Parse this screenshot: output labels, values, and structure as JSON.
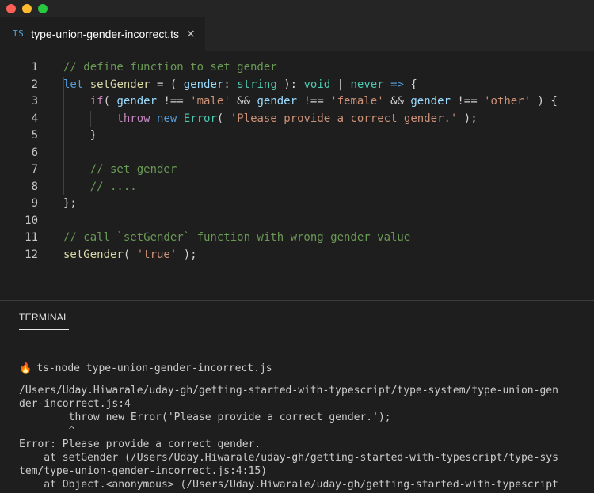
{
  "window": {
    "tab": {
      "icon": "TS",
      "filename": "type-union-gender-incorrect.ts",
      "close_glyph": "×"
    }
  },
  "editor": {
    "lines": [
      {
        "num": "1",
        "tokens": [
          {
            "t": "// define function to set gender",
            "c": "comment"
          }
        ]
      },
      {
        "num": "2",
        "tokens": [
          {
            "t": "let",
            "c": "keyword"
          },
          {
            "t": " ",
            "c": "punct"
          },
          {
            "t": "setGender",
            "c": "func"
          },
          {
            "t": " = ( ",
            "c": "punct"
          },
          {
            "t": "gender",
            "c": "var"
          },
          {
            "t": ": ",
            "c": "punct"
          },
          {
            "t": "string",
            "c": "type"
          },
          {
            "t": " ): ",
            "c": "punct"
          },
          {
            "t": "void",
            "c": "type"
          },
          {
            "t": " | ",
            "c": "punct"
          },
          {
            "t": "never",
            "c": "type"
          },
          {
            "t": " ",
            "c": "punct"
          },
          {
            "t": "=>",
            "c": "keyword"
          },
          {
            "t": " {",
            "c": "punct"
          }
        ]
      },
      {
        "num": "3",
        "tokens": [
          {
            "t": "    ",
            "c": "punct"
          },
          {
            "t": "if",
            "c": "control"
          },
          {
            "t": "( ",
            "c": "punct"
          },
          {
            "t": "gender",
            "c": "var"
          },
          {
            "t": " !== ",
            "c": "punct"
          },
          {
            "t": "'male'",
            "c": "string"
          },
          {
            "t": " && ",
            "c": "punct"
          },
          {
            "t": "gender",
            "c": "var"
          },
          {
            "t": " !== ",
            "c": "punct"
          },
          {
            "t": "'female'",
            "c": "string"
          },
          {
            "t": " && ",
            "c": "punct"
          },
          {
            "t": "gender",
            "c": "var"
          },
          {
            "t": " !== ",
            "c": "punct"
          },
          {
            "t": "'other'",
            "c": "string"
          },
          {
            "t": " ) {",
            "c": "punct"
          }
        ]
      },
      {
        "num": "4",
        "tokens": [
          {
            "t": "        ",
            "c": "punct"
          },
          {
            "t": "throw",
            "c": "control"
          },
          {
            "t": " ",
            "c": "punct"
          },
          {
            "t": "new",
            "c": "keyword"
          },
          {
            "t": " ",
            "c": "punct"
          },
          {
            "t": "Error",
            "c": "type"
          },
          {
            "t": "( ",
            "c": "punct"
          },
          {
            "t": "'Please provide a correct gender.'",
            "c": "string"
          },
          {
            "t": " );",
            "c": "punct"
          }
        ]
      },
      {
        "num": "5",
        "tokens": [
          {
            "t": "    }",
            "c": "punct"
          }
        ]
      },
      {
        "num": "6",
        "tokens": []
      },
      {
        "num": "7",
        "tokens": [
          {
            "t": "    ",
            "c": "punct"
          },
          {
            "t": "// set gender",
            "c": "comment"
          }
        ]
      },
      {
        "num": "8",
        "tokens": [
          {
            "t": "    ",
            "c": "punct"
          },
          {
            "t": "// ....",
            "c": "comment"
          }
        ]
      },
      {
        "num": "9",
        "tokens": [
          {
            "t": "};",
            "c": "punct"
          }
        ]
      },
      {
        "num": "10",
        "tokens": []
      },
      {
        "num": "11",
        "tokens": [
          {
            "t": "// call `setGender` function with wrong gender value",
            "c": "comment"
          }
        ]
      },
      {
        "num": "12",
        "tokens": [
          {
            "t": "setGender",
            "c": "func"
          },
          {
            "t": "( ",
            "c": "punct"
          },
          {
            "t": "'true'",
            "c": "string"
          },
          {
            "t": " );",
            "c": "punct"
          }
        ]
      }
    ]
  },
  "panel": {
    "tab_label": "TERMINAL",
    "prompt_icon": "fire-icon",
    "command": "ts-node type-union-gender-incorrect.js",
    "output_lines": [
      "/Users/Uday.Hiwarale/uday-gh/getting-started-with-typescript/type-system/type-union-gen",
      "der-incorrect.js:4",
      "        throw new Error('Please provide a correct gender.');",
      "        ^",
      "Error: Please provide a correct gender.",
      "    at setGender (/Users/Uday.Hiwarale/uday-gh/getting-started-with-typescript/type-sys",
      "tem/type-union-gender-incorrect.js:4:15)",
      "    at Object.<anonymous> (/Users/Uday.Hiwarale/uday-gh/getting-started-with-typescript"
    ]
  }
}
